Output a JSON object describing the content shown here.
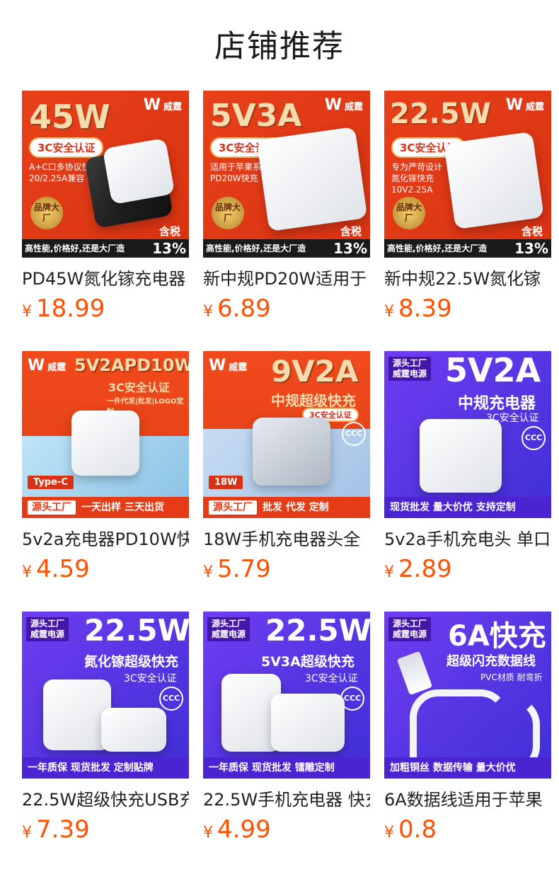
{
  "page": {
    "title": "店铺推荐"
  },
  "products": [
    {
      "title": "PD45W氮化镓充电器",
      "currency": "¥",
      "price": "18.99",
      "thumb": {
        "headline": "45W",
        "brand": "威霆",
        "badge": "3C安全认证",
        "spec1": "A+C口多协议快充",
        "spec2": "20/2.25A兼容",
        "seal": "品牌大厂",
        "tax": "含税",
        "strip": "高性能,价格好,还是大厂造",
        "pct": "13%"
      }
    },
    {
      "title": "新中规PD20W适用于",
      "currency": "¥",
      "price": "6.89",
      "thumb": {
        "headline": "5V3A",
        "brand": "威霆",
        "badge": "3C安全认证",
        "spec1": "适用于苹果系列",
        "spec2": "PD20W快充",
        "seal": "品牌大厂",
        "tax": "含税",
        "strip": "高性能,价格好,还是大厂造",
        "pct": "13%"
      }
    },
    {
      "title": "新中规22.5W氮化镓",
      "currency": "¥",
      "price": "8.39",
      "thumb": {
        "headline": "22.5W",
        "brand": "威霆",
        "badge": "3C安全认证",
        "spec1": "专为严苛设计",
        "spec2": "氮化镓快充",
        "spec3": "10V2.25A",
        "seal": "品牌大厂",
        "tax": "含税",
        "strip": "高性能,价格好,还是大厂造",
        "pct": "13%"
      }
    },
    {
      "title": "5v2a充电器PD10W快",
      "currency": "¥",
      "price": "4.59",
      "thumb": {
        "headline": "5V2APD10W",
        "brand": "威霆",
        "badge": "3C安全认证",
        "sub": "一件代发|批发|LOGO定制",
        "tag": "Type-C",
        "source": "源头工厂",
        "strip": "一天出样 三天出货"
      }
    },
    {
      "title": "18W手机充电器头全",
      "currency": "¥",
      "price": "5.79",
      "thumb": {
        "headline": "9V2A",
        "brand": "威霆",
        "sub": "中规超级快充",
        "badge": "3C安全认证",
        "tag": "18W",
        "source": "源头工厂",
        "strip": "批发 代发 定制"
      }
    },
    {
      "title": "5v2a手机充电头 单口",
      "currency": "¥",
      "price": "2.89",
      "thumb": {
        "headline": "5V2A",
        "corner1": "源头工厂",
        "corner2": "威霆电源",
        "sub": "中规充电器",
        "badge": "3C安全认证",
        "strip": "现货批发 量大价优 支持定制"
      }
    },
    {
      "title": "22.5W超级快充USB充",
      "currency": "¥",
      "price": "7.39",
      "thumb": {
        "headline": "22.5W",
        "corner1": "源头工厂",
        "corner2": "威霆电源",
        "sub": "氮化镓超级快充",
        "badge": "3C安全认证",
        "strip": "一年质保 现货批发 定制贴牌"
      }
    },
    {
      "title": "22.5W手机充电器 快充",
      "currency": "¥",
      "price": "4.99",
      "thumb": {
        "headline": "22.5W",
        "corner1": "源头工厂",
        "corner2": "威霆电源",
        "sub": "5V3A超级快充",
        "badge": "3C安全认证",
        "strip": "一年质保 现货批发 镭雕定制"
      }
    },
    {
      "title": "6A数据线适用于苹果",
      "currency": "¥",
      "price": "0.8",
      "thumb": {
        "headline": "6A快充",
        "corner1": "源头工厂",
        "corner2": "威霆电源",
        "sub": "超级闪充数据线",
        "badge": "PVC材质 耐弯折",
        "strip": "加粗铜丝 数据传输 量大价优"
      }
    }
  ],
  "colors": {
    "price": "#ff5000",
    "red_bg": "#e23d16",
    "purple_bg": "#5a34e6"
  }
}
